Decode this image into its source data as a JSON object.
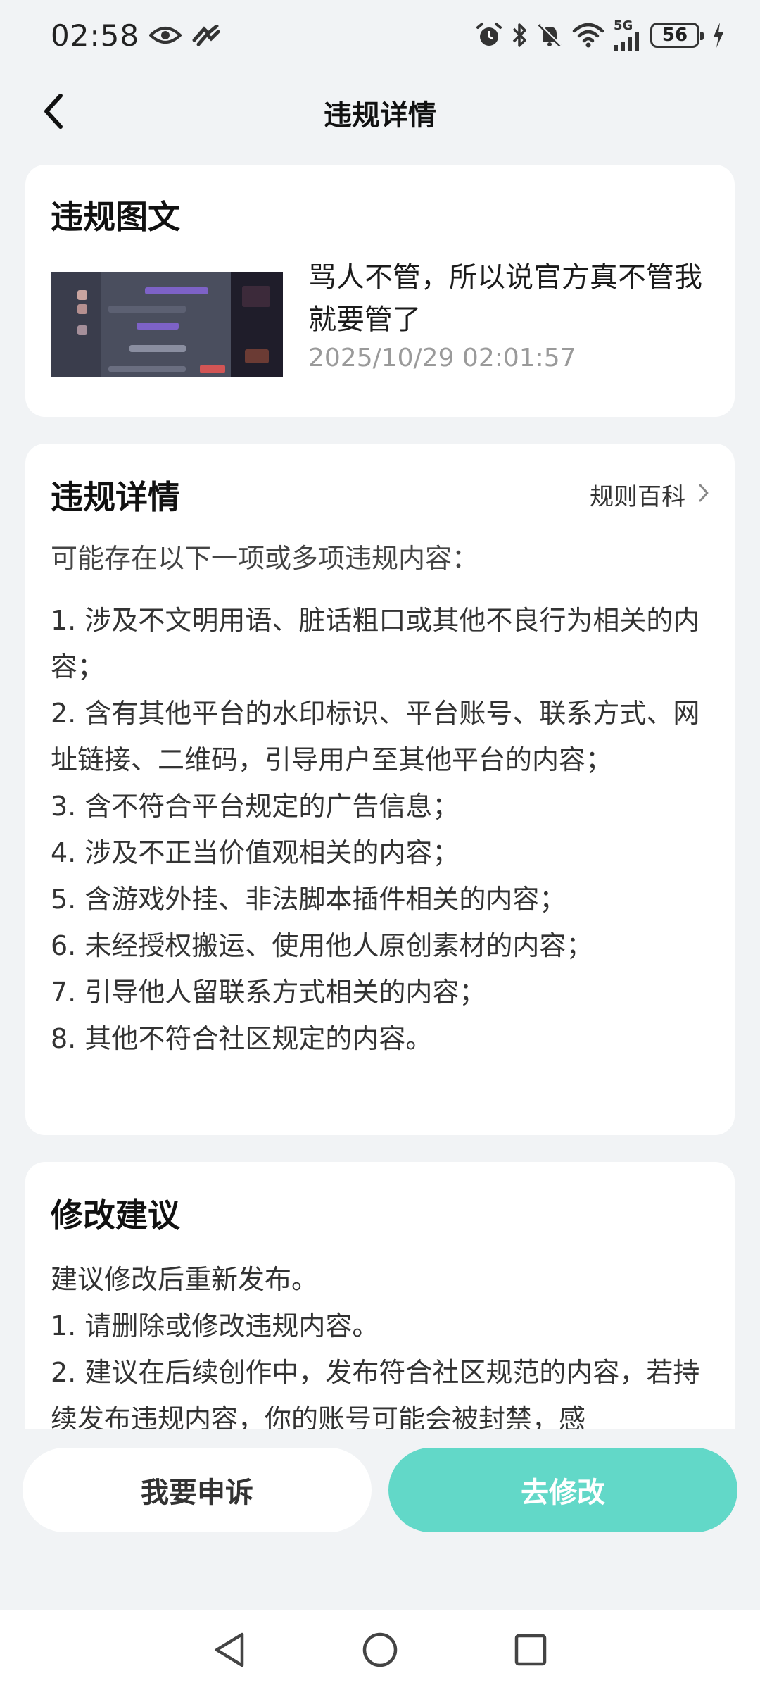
{
  "status_bar": {
    "time": "02:58",
    "battery": "56",
    "network": "5G",
    "icons": [
      "eye-icon",
      "vpn-icon",
      "alarm-icon",
      "bluetooth-icon",
      "mute-bell-icon",
      "wifi-icon",
      "signal-icon",
      "charging-icon"
    ]
  },
  "header": {
    "title": "违规详情",
    "back_icon": "chevron-left-icon"
  },
  "post": {
    "section_title": "违规图文",
    "text": "骂人不管，所以说官方真不管我就要管了",
    "timestamp": "2025/10/29 02:01:57"
  },
  "violation": {
    "section_title": "违规详情",
    "rules_link": "规则百科",
    "intro": "可能存在以下一项或多项违规内容：",
    "items": [
      "1. 涉及不文明用语、脏话粗口或其他不良行为相关的内容；",
      "2. 含有其他平台的水印标识、平台账号、联系方式、网址链接、二维码，引导用户至其他平台的内容；",
      "3. 含不符合平台规定的广告信息；",
      "4. 涉及不正当价值观相关的内容；",
      "5. 含游戏外挂、非法脚本插件相关的内容；",
      "6. 未经授权搬运、使用他人原创素材的内容；",
      "7. 引导他人留联系方式相关的内容；",
      "8. 其他不符合社区规定的内容。"
    ]
  },
  "advice": {
    "section_title": "修改建议",
    "lines": [
      "建议修改后重新发布。",
      "1. 请删除或修改违规内容。",
      "2. 建议在后续创作中，发布符合社区规范的内容，若持续发布违规内容，你的账号可能会被封禁，感"
    ]
  },
  "actions": {
    "appeal_label": "我要申诉",
    "edit_label": "去修改"
  },
  "colors": {
    "accent": "#62d8c8",
    "background": "#f1f3f5",
    "card": "#ffffff"
  }
}
